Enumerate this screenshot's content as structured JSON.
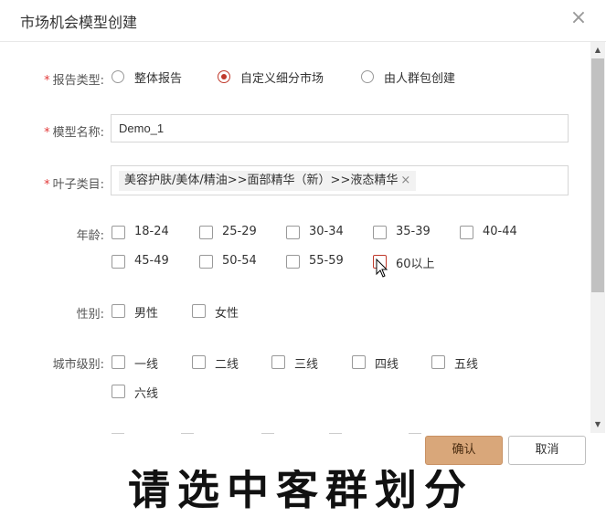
{
  "dialog": {
    "title": "市场机会模型创建",
    "close_glyph": "×"
  },
  "report_type": {
    "label": "报告类型:",
    "required_mark": "*",
    "options": [
      {
        "label": "整体报告",
        "checked": false
      },
      {
        "label": "自定义细分市场",
        "checked": true
      },
      {
        "label": "由人群包创建",
        "checked": false
      }
    ]
  },
  "model_name": {
    "label": "模型名称:",
    "required_mark": "*",
    "value": "Demo_1"
  },
  "leaf_category": {
    "label": "叶子类目:",
    "required_mark": "*",
    "tags": [
      {
        "text": "美容护肤/美体/精油>>面部精华（新）>>液态精华",
        "close": "×"
      }
    ]
  },
  "age": {
    "label": "年龄:",
    "options": [
      "18-24",
      "25-29",
      "30-34",
      "35-39",
      "40-44",
      "45-49",
      "50-54",
      "55-59",
      "60以上"
    ]
  },
  "gender": {
    "label": "性别:",
    "options": [
      "男性",
      "女性"
    ]
  },
  "city_level": {
    "label": "城市级别:",
    "options": [
      "一线",
      "二线",
      "三线",
      "四线",
      "五线",
      "六线"
    ]
  },
  "footer": {
    "confirm_label": "确认",
    "cancel_label": "取消"
  },
  "backdrop": {
    "text": "请选中客群划分"
  },
  "colors": {
    "accent": "#c0392b",
    "confirm_bg": "#d9a77a",
    "required": "#e23a3a"
  }
}
